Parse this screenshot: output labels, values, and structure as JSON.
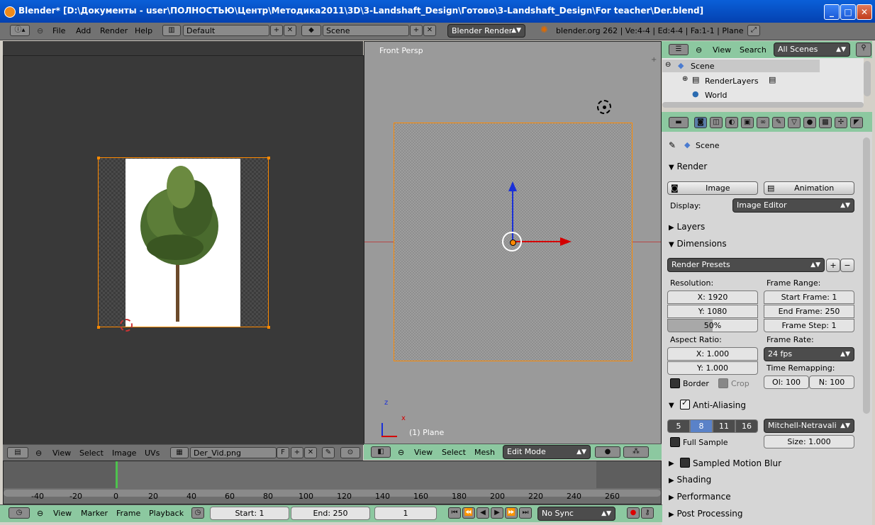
{
  "window": {
    "title": "Blender* [D:\\Документы - user\\ПОЛНОСТЬЮ\\Центр\\Методика2011\\3D\\3-Landshaft_Design\\Готово\\3-Landshaft_Design\\For teacher\\Der.blend]",
    "buttons": [
      "_",
      "□",
      "✕"
    ]
  },
  "info_header": {
    "menus": [
      "File",
      "Add",
      "Render",
      "Help"
    ],
    "screen_layout": "Default",
    "scene": "Scene",
    "render_engine": "Blender Render",
    "stats": "blender.org 262 | Ve:4-4 | Ed:4-4 | Fa:1-1 | Plane"
  },
  "uv_editor": {
    "header_menus": [
      "View",
      "Select",
      "Image",
      "UVs"
    ],
    "image_name": "Der_Vid.png",
    "fake_user": "F"
  },
  "viewport": {
    "view_label": "Front Persp",
    "object_label": "(1) Plane",
    "header_menus": [
      "View",
      "Select",
      "Mesh"
    ],
    "mode": "Edit Mode",
    "axis_z": "z",
    "axis_x": "x"
  },
  "outliner": {
    "menus": [
      "View",
      "Search"
    ],
    "filter": "All Scenes",
    "tree": [
      "Scene",
      "RenderLayers",
      "World"
    ]
  },
  "properties": {
    "context": "Scene",
    "render": {
      "title": "Render",
      "image_btn": "Image",
      "animation_btn": "Animation",
      "display_label": "Display:",
      "display_value": "Image Editor"
    },
    "layers_title": "Layers",
    "dimensions": {
      "title": "Dimensions",
      "presets": "Render Presets",
      "resolution_label": "Resolution:",
      "res_x": "X: 1920",
      "res_y": "Y: 1080",
      "res_pct": "50%",
      "frame_range_label": "Frame Range:",
      "start_frame": "Start Frame: 1",
      "end_frame": "End Frame: 250",
      "frame_step": "Frame Step: 1",
      "aspect_label": "Aspect Ratio:",
      "aspect_x": "X: 1.000",
      "aspect_y": "Y: 1.000",
      "frame_rate_label": "Frame Rate:",
      "frame_rate": "24 fps",
      "time_remap_label": "Time Remapping:",
      "remap_old": "Ol: 100",
      "remap_new": "N: 100",
      "border": "Border",
      "crop": "Crop"
    },
    "anti_aliasing": {
      "title": "Anti-Aliasing",
      "samples": [
        "5",
        "8",
        "11",
        "16"
      ],
      "selected_sample": "8",
      "filter": "Mitchell-Netravali",
      "full_sample": "Full Sample",
      "size": "Size: 1.000"
    },
    "sampled_motion_blur": "Sampled Motion Blur",
    "shading": "Shading",
    "performance": "Performance",
    "post_processing": "Post Processing"
  },
  "timeline": {
    "ticks": [
      "-40",
      "-20",
      "0",
      "20",
      "40",
      "60",
      "80",
      "100",
      "120",
      "140",
      "160",
      "180",
      "200",
      "220",
      "240",
      "260"
    ],
    "current_frame_value": 0,
    "menus": [
      "View",
      "Marker",
      "Frame",
      "Playback"
    ],
    "start": "Start: 1",
    "end": "End: 250",
    "current": "1",
    "sync": "No Sync"
  },
  "colors": {
    "titlebar": "#0a5fd8",
    "header_green": "#8cc8a0",
    "selection_orange": "#ff8a00",
    "axis_red": "#d40000",
    "axis_blue": "#1a30d8",
    "timeline_cursor": "#4ec24e"
  }
}
